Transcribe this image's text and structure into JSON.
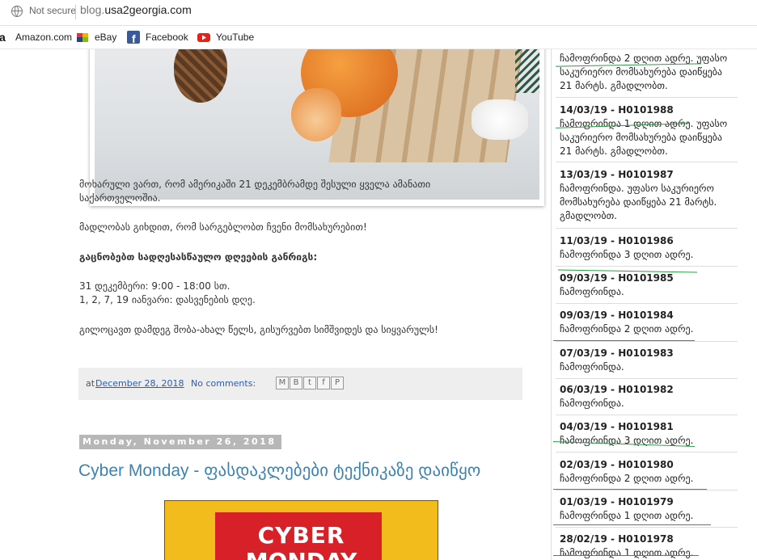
{
  "browser": {
    "security": "Not secure",
    "url_host": "blog.",
    "url_domain": "usa2georgia.com"
  },
  "bookmarks": [
    {
      "label": "Amazon.com",
      "icon": "amazon-icon"
    },
    {
      "label": "eBay",
      "icon": "ebay-icon"
    },
    {
      "label": "Facebook",
      "icon": "facebook-icon"
    },
    {
      "label": "YouTube",
      "icon": "youtube-icon"
    }
  ],
  "post": {
    "para1_line1": "მოხარული ვართ, რომ ამერიკაში 21 დეკემბრამდე შესული ყველა ამანათი",
    "para1_line2": "საქართველოშია.",
    "para2": "მადლობას გიხდით, რომ სარგებლობთ ჩვენი მომსახურებით!",
    "schedule_heading": "გაცნობებთ სადღესასწაულო დღეების განრიგს:",
    "schedule_line1": "31 დეკემბერი: 9:00 - 18:00 სთ.",
    "schedule_line2": "1, 2, 7, 19 იანვარი: დასვენების დღე.",
    "greeting": "გილოცავთ დამდეგ შობა-ახალ წელს, გისურვებთ სიმშვიდეს და სიყვარულს!",
    "footer_at": "at",
    "footer_date": "December 28, 2018",
    "footer_comments": "No comments:",
    "share_icons": [
      "email-icon",
      "blogger-icon",
      "twitter-icon",
      "facebook-icon",
      "pinterest-icon"
    ]
  },
  "next_post": {
    "date_header": "Monday, November 26, 2018",
    "title": "Cyber Monday - ფასდაკლებები ტექნიკაზე დაიწყო",
    "banner_line1": "CYBER",
    "banner_line2": "MONDAY"
  },
  "sidebar": {
    "top_line1": "ჩამოფრინდა 2 დღით ადრე. უფასო",
    "top_line2": "საკურიერო მომსახურება დაიწყება",
    "top_line3": "21 მარტს. გმადლობთ.",
    "entries": [
      {
        "title": "14/03/19 - H0101988",
        "lines": [
          "ჩამოფრინდა 1 დღით ადრე. უფასო",
          "საკურიერო მომსახურება დაიწყება",
          "21 მარტს. გმადლობთ."
        ]
      },
      {
        "title": "13/03/19 - H0101987",
        "lines": [
          "ჩამოფრინდა. უფასო საკურიერო",
          "მომსახურება დაიწყება 21 მარტს.",
          "გმადლობთ."
        ]
      },
      {
        "title": "11/03/19 - H0101986",
        "lines": [
          "ჩამოფრინდა 3 დღით ადრე."
        ]
      },
      {
        "title": "09/03/19 - H0101985",
        "lines": [
          "ჩამოფრინდა."
        ]
      },
      {
        "title": "09/03/19 - H0101984",
        "lines": [
          "ჩამოფრინდა 2 დღით ადრე."
        ]
      },
      {
        "title": "07/03/19 - H0101983",
        "lines": [
          "ჩამოფრინდა."
        ]
      },
      {
        "title": "06/03/19 - H0101982",
        "lines": [
          "ჩამოფრინდა."
        ]
      },
      {
        "title": "04/03/19 - H0101981",
        "lines": [
          "ჩამოფრინდა 3 დღით ადრე."
        ]
      },
      {
        "title": "02/03/19 - H0101980",
        "lines": [
          "ჩამოფრინდა 2 დღით ადრე."
        ]
      },
      {
        "title": "01/03/19 - H0101979",
        "lines": [
          "ჩამოფრინდა 1 დღით ადრე."
        ]
      },
      {
        "title": "28/02/19 - H0101978",
        "lines": [
          "ჩამოფრინდა 1 დღით ადრე."
        ]
      }
    ]
  }
}
